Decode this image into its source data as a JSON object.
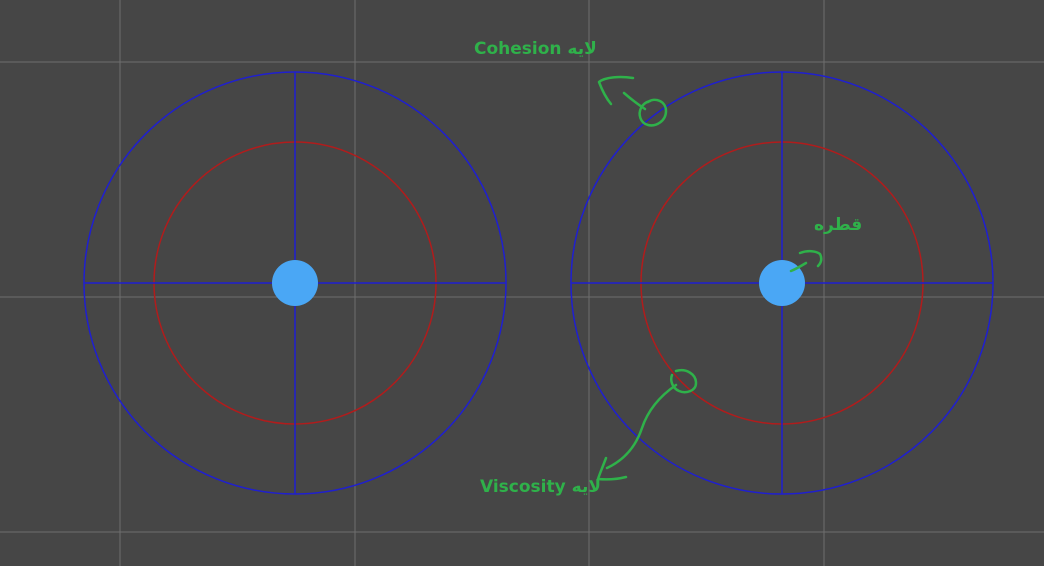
{
  "colors": {
    "background": "#464646",
    "grid_line": "#6e6e6e",
    "outer_circle": "#1f1fd0",
    "inner_circle": "#b11c1c",
    "crosshair": "#1f1fd0",
    "particle": "#4aa7f5",
    "annotation": "#2fb14a"
  },
  "annotations": {
    "cohesion_label": "لایه Cohesion",
    "droplet_label": "قطره",
    "viscosity_label": "لایه Viscosity"
  }
}
